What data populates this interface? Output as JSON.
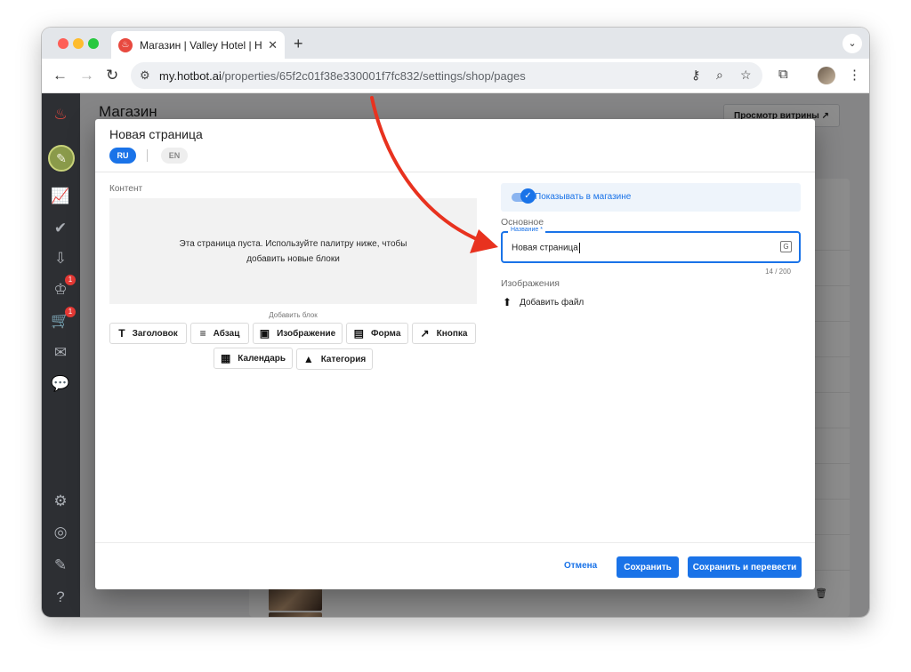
{
  "browser": {
    "tab_title": "Магазин | Valley Hotel | Hotbot",
    "new_tab_symbol": "+",
    "url_host": "my.hotbot.ai",
    "url_path": "/properties/65f2c01f38e330001f7fc832/settings/shop/pages"
  },
  "sidebar": {
    "badges": [
      "1",
      "1"
    ],
    "icons": [
      "flame-icon",
      "analytics-icon",
      "check-circle-icon",
      "inbox-icon",
      "bot-icon",
      "cart-icon",
      "mail-icon",
      "chat-icon",
      "settings-icon",
      "profile-icon",
      "edit-icon",
      "help-icon"
    ]
  },
  "page": {
    "title": "Магазин",
    "preview_button": "Просмотр витрины ↗"
  },
  "modal": {
    "title": "Новая страница",
    "languages": [
      "RU",
      "EN"
    ],
    "active_language": "RU",
    "content_label": "Контент",
    "empty_message": "Эта страница пуста. Используйте палитру ниже, чтобы добавить новые блоки",
    "add_block_label": "Добавить блок",
    "blocks": [
      {
        "label": "Заголовок",
        "icon": "title-icon"
      },
      {
        "label": "Абзац",
        "icon": "paragraph-icon"
      },
      {
        "label": "Изображение",
        "icon": "image-icon"
      },
      {
        "label": "Форма",
        "icon": "form-icon"
      },
      {
        "label": "Кнопка",
        "icon": "external-link-icon"
      },
      {
        "label": "Календарь",
        "icon": "calendar-icon"
      },
      {
        "label": "Категория",
        "icon": "category-icon"
      }
    ],
    "show_in_shop_label": "Показывать в магазине",
    "show_in_shop": true,
    "basic_section": "Основное",
    "name_field": {
      "label": "Название *",
      "value": "Новая страница",
      "counter": "14 / 200"
    },
    "images_section": "Изображения",
    "add_file": "Добавить файл",
    "footer": {
      "cancel": "Отмена",
      "save": "Сохранить",
      "save_translate": "Сохранить и перевести"
    }
  },
  "colors": {
    "accent": "#1a73e8",
    "annotation_arrow": "#e8321f",
    "sidebar": "#2d2f33"
  }
}
